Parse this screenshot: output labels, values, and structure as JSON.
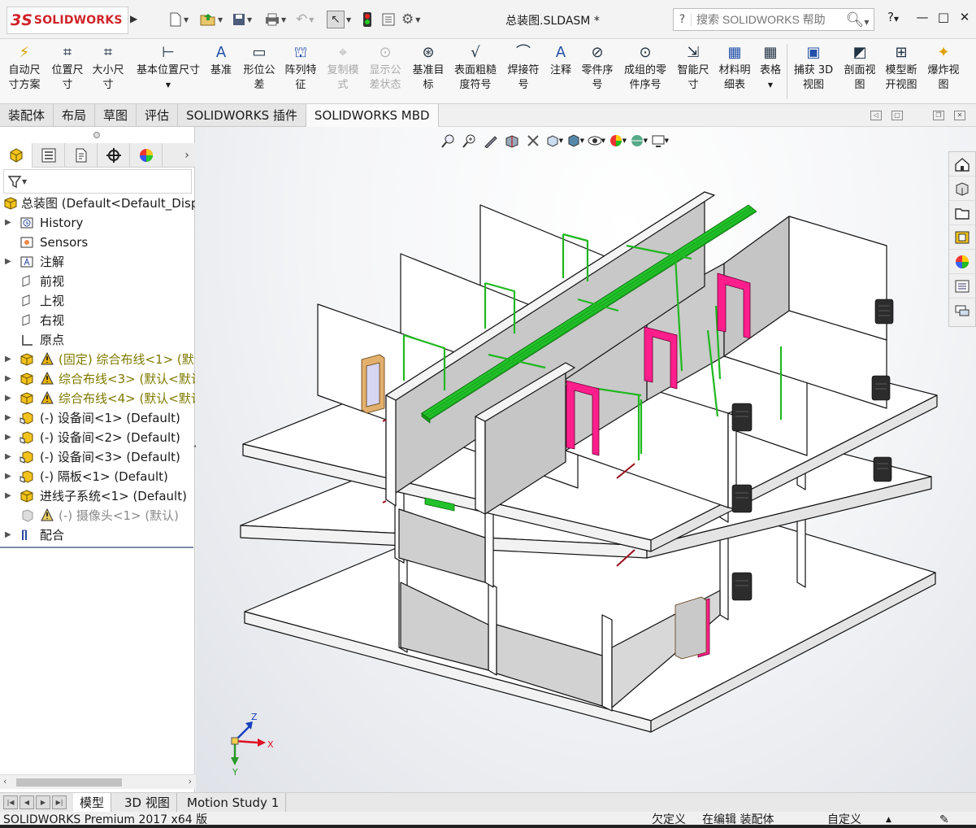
{
  "app": {
    "brand_mark": "3S",
    "brand_name": "SOLIDWORKS"
  },
  "document": {
    "title": "总装图.SLDASM *"
  },
  "search": {
    "placeholder": "搜索 SOLIDWORKS 帮助"
  },
  "window_controls": [
    "?",
    "—",
    "□",
    "✕"
  ],
  "command_manager": {
    "items": [
      {
        "label1": "自动尺",
        "label2": "寸方案",
        "icon": "auto-dimension-icon",
        "enabled": true
      },
      {
        "label1": "位置尺",
        "label2": "寸",
        "icon": "location-dimension-icon",
        "enabled": true
      },
      {
        "label1": "大小尺",
        "label2": "寸",
        "icon": "size-dimension-icon",
        "enabled": true
      },
      {
        "label1": "基本位置尺寸",
        "label2": "",
        "icon": "basic-location-dimension-icon",
        "enabled": true
      },
      {
        "label1": "基准",
        "label2": "",
        "icon": "datum-icon",
        "enabled": true
      },
      {
        "label1": "形位公",
        "label2": "差",
        "icon": "geometric-tolerance-icon",
        "enabled": true
      },
      {
        "label1": "阵列特",
        "label2": "征",
        "icon": "pattern-feature-icon",
        "enabled": true
      },
      {
        "label1": "复制模",
        "label2": "式",
        "icon": "copy-scheme-icon",
        "enabled": false
      },
      {
        "label1": "显示公",
        "label2": "差状态",
        "icon": "tolerance-status-icon",
        "enabled": false
      },
      {
        "label1": "基准目",
        "label2": "标",
        "icon": "datum-target-icon",
        "enabled": true
      },
      {
        "label1": "表面粗糙",
        "label2": "度符号",
        "icon": "surface-finish-icon",
        "enabled": true
      },
      {
        "label1": "焊接符",
        "label2": "号",
        "icon": "weld-symbol-icon",
        "enabled": true
      },
      {
        "label1": "注释",
        "label2": "",
        "icon": "note-icon",
        "enabled": true
      },
      {
        "label1": "零件序",
        "label2": "号",
        "icon": "balloon-icon",
        "enabled": true
      },
      {
        "label1": "成组的零",
        "label2": "件序号",
        "icon": "stacked-balloon-icon",
        "enabled": true
      },
      {
        "label1": "智能尺",
        "label2": "寸",
        "icon": "smart-dimension-icon",
        "enabled": true
      },
      {
        "label1": "材料明",
        "label2": "细表",
        "icon": "bom-icon",
        "enabled": true
      },
      {
        "label1": "表格",
        "label2": "",
        "icon": "table-icon",
        "enabled": true
      },
      {
        "label1": "捕获 3D",
        "label2": "视图",
        "icon": "capture-3d-view-icon",
        "enabled": true
      },
      {
        "label1": "剖面视",
        "label2": "图",
        "icon": "section-view-icon",
        "enabled": true
      },
      {
        "label1": "模型断",
        "label2": "开视图",
        "icon": "model-break-view-icon",
        "enabled": true
      },
      {
        "label1": "爆炸视",
        "label2": "图",
        "icon": "exploded-view-icon",
        "enabled": true
      }
    ]
  },
  "tabs": [
    "装配体",
    "布局",
    "草图",
    "评估",
    "SOLIDWORKS 插件",
    "SOLIDWORKS MBD"
  ],
  "active_tab": "SOLIDWORKS MBD",
  "feature_tree": {
    "root": "总装图  (Default<Default_Disp",
    "items": [
      {
        "label": "History",
        "expand": true,
        "warn": false,
        "style": "normal",
        "icon": "history-icon"
      },
      {
        "label": "Sensors",
        "expand": false,
        "warn": false,
        "style": "normal",
        "icon": "sensors-icon"
      },
      {
        "label": "注解",
        "expand": true,
        "warn": false,
        "style": "normal",
        "icon": "annotations-icon"
      },
      {
        "label": "前视",
        "expand": false,
        "warn": false,
        "style": "normal",
        "icon": "plane-icon"
      },
      {
        "label": "上视",
        "expand": false,
        "warn": false,
        "style": "normal",
        "icon": "plane-icon"
      },
      {
        "label": "右视",
        "expand": false,
        "warn": false,
        "style": "normal",
        "icon": "plane-icon"
      },
      {
        "label": "原点",
        "expand": false,
        "warn": false,
        "style": "normal",
        "icon": "origin-icon"
      },
      {
        "label": "(固定) 综合布线<1> (默认",
        "expand": true,
        "warn": true,
        "style": "olive",
        "icon": "subassembly-icon"
      },
      {
        "label": "综合布线<3> (默认<默认",
        "expand": true,
        "warn": true,
        "style": "olive",
        "icon": "subassembly-icon"
      },
      {
        "label": "综合布线<4> (默认<默认",
        "expand": true,
        "warn": true,
        "style": "olive",
        "icon": "subassembly-icon"
      },
      {
        "label": "(-) 设备间<1> (Default)",
        "expand": true,
        "warn": false,
        "style": "normal",
        "icon": "part-icon"
      },
      {
        "label": "(-) 设备间<2> (Default)",
        "expand": true,
        "warn": false,
        "style": "normal",
        "icon": "part-icon"
      },
      {
        "label": "(-) 设备间<3> (Default)",
        "expand": true,
        "warn": false,
        "style": "normal",
        "icon": "part-icon"
      },
      {
        "label": "(-) 隔板<1> (Default)",
        "expand": true,
        "warn": false,
        "style": "normal",
        "icon": "part-icon"
      },
      {
        "label": "进线子系统<1> (Default)",
        "expand": true,
        "warn": false,
        "style": "normal",
        "icon": "subassembly-icon"
      },
      {
        "label": "(-) 摄像头<1> (默认)",
        "expand": false,
        "warn": true,
        "style": "grey",
        "icon": "suppressed-part-icon"
      },
      {
        "label": "配合",
        "expand": true,
        "warn": false,
        "style": "normal",
        "icon": "mates-icon"
      }
    ]
  },
  "triad": {
    "x": "X",
    "y": "Y",
    "z": "Z"
  },
  "bottom_tabs": [
    "模型",
    "3D 视图",
    "Motion Study 1"
  ],
  "active_bottom_tab": "模型",
  "status": {
    "product": "SOLIDWORKS Premium 2017 x64 版",
    "definition": "欠定义",
    "mode": "在编辑 装配体",
    "units": "自定义"
  },
  "colors": {
    "brand": "#d0232a",
    "cable_tray": "#22c22a",
    "door": "#ff1e8c",
    "panel": "#ffffff",
    "wall_shade": "#c8c8c8",
    "warning": "#e8b200"
  }
}
